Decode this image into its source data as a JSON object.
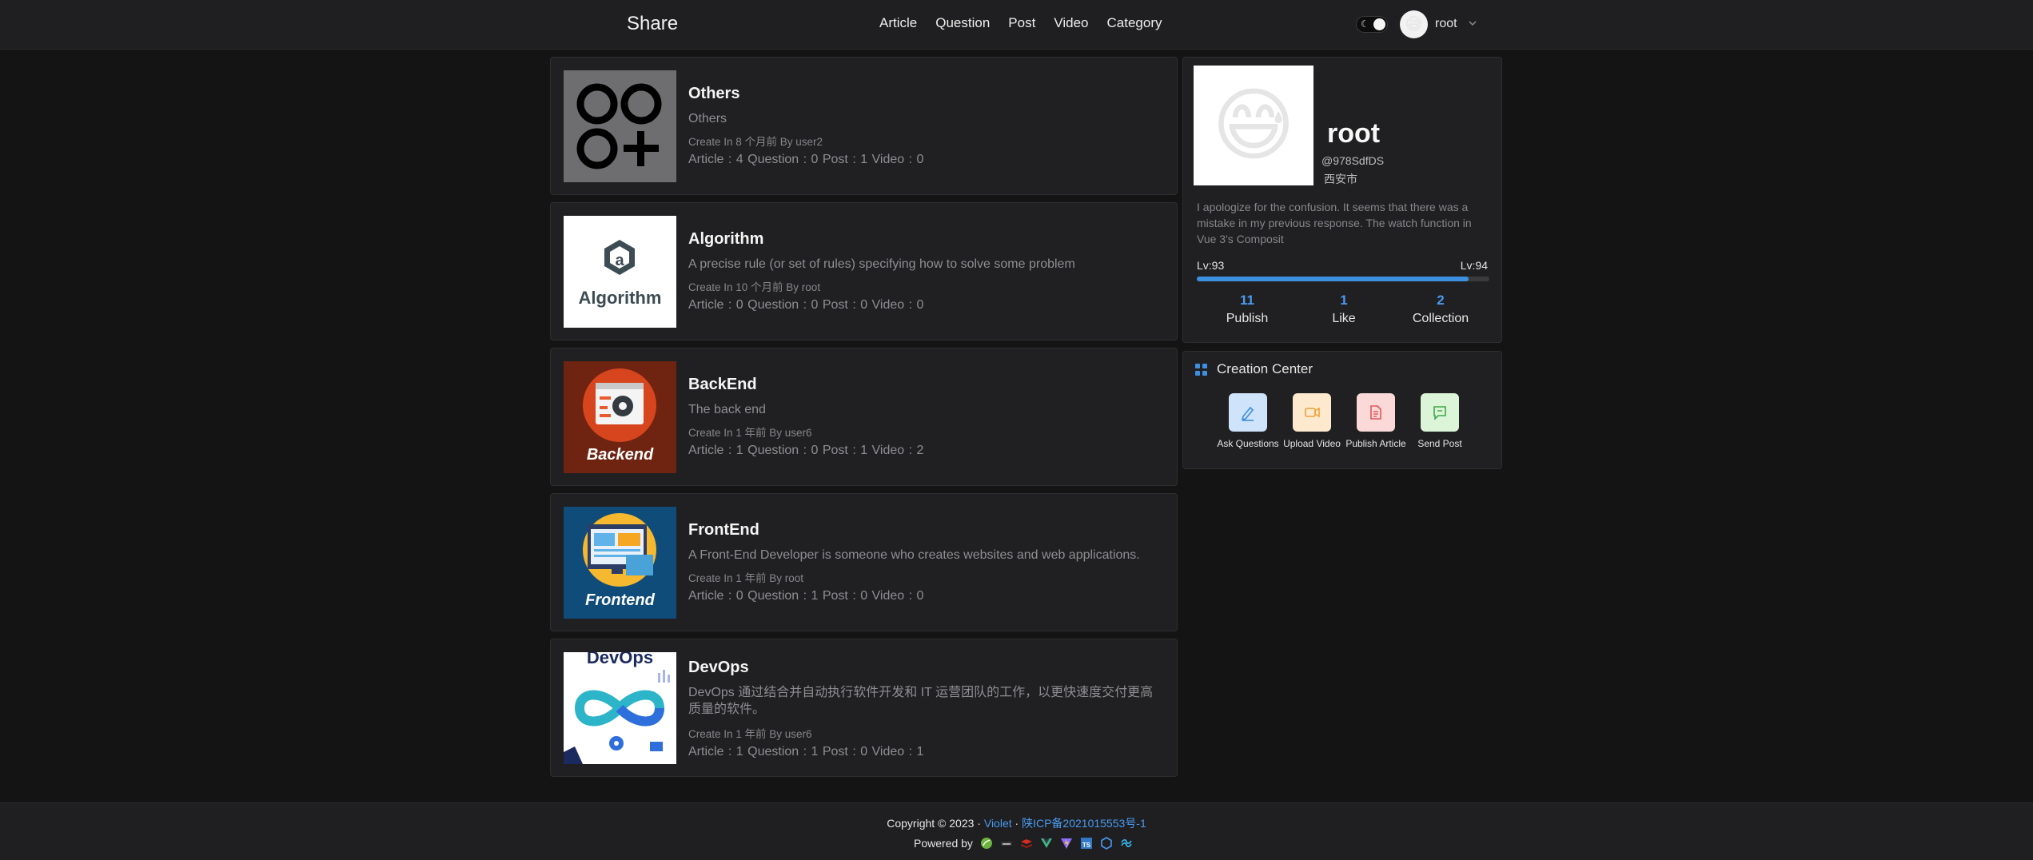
{
  "header": {
    "brand": "Share",
    "nav": [
      "Article",
      "Question",
      "Post",
      "Video",
      "Category"
    ],
    "user": "root",
    "avatar_emoji": "😅"
  },
  "categories": [
    {
      "title": "Others",
      "desc": "Others",
      "meta": "Create In 8 个月前 By user2",
      "stats": "Article : 4   Question : 0   Post : 1   Video : 0",
      "thumb": "others-icon"
    },
    {
      "title": "Algorithm",
      "desc": "A precise rule (or set of rules) specifying how to solve some problem",
      "meta": "Create In 10 个月前 By root",
      "stats": "Article : 0   Question : 0   Post : 0   Video : 0",
      "thumb": "algorithm-logo",
      "thumb_text": "Algorithm"
    },
    {
      "title": "BackEnd",
      "desc": "The back end",
      "meta": "Create In 1 年前 By user6",
      "stats": "Article : 1   Question : 0   Post : 1   Video : 2",
      "thumb": "backend-logo",
      "thumb_text": "Backend"
    },
    {
      "title": "FrontEnd",
      "desc": "A Front-End Developer is someone who creates websites and web applications.",
      "meta": "Create In 1 年前 By root",
      "stats": "Article : 0   Question : 1   Post : 0   Video : 0",
      "thumb": "frontend-logo",
      "thumb_text": "Frontend"
    },
    {
      "title": "DevOps",
      "desc": "DevOps 通过结合并自动执行软件开发和 IT 运营团队的工作，以更快速度交付更高质量的软件。",
      "meta": "Create In 1 年前 By user6",
      "stats": "Article : 1   Question : 1   Post : 0   Video : 1",
      "thumb": "devops-logo",
      "thumb_text": "DevOps"
    }
  ],
  "profile": {
    "name": "root",
    "handle": "@978SdfDS",
    "city": "西安市",
    "bio": "I apologize for the confusion. It seems that there was a mistake in my previous response. The watch function in Vue 3's Composit",
    "level_current": "Lv:93",
    "level_next": "Lv:94",
    "level_progress": 0.93,
    "stats": [
      {
        "num": "11",
        "label": "Publish"
      },
      {
        "num": "1",
        "label": "Like"
      },
      {
        "num": "2",
        "label": "Collection"
      }
    ]
  },
  "creation": {
    "title": "Creation Center",
    "tools": [
      {
        "label": "Ask Questions",
        "icon": "pen-icon",
        "bg": "#cfe3fb",
        "fg": "#3d8fe0"
      },
      {
        "label": "Upload Video",
        "icon": "video-icon",
        "bg": "#fde9cd",
        "fg": "#f0a33c"
      },
      {
        "label": "Publish Article",
        "icon": "document-icon",
        "bg": "#fbd9d9",
        "fg": "#e25555"
      },
      {
        "label": "Send Post",
        "icon": "chat-icon",
        "bg": "#dcf5d8",
        "fg": "#3ea64a"
      }
    ]
  },
  "footer": {
    "copyright": "Copyright © 2023 · ",
    "author": "Violet",
    "sep": " · ",
    "icp": "陕ICP备2021015553号-1",
    "powered": "Powered by"
  },
  "colors": {
    "accent": "#3d8fe0",
    "background": "#141414",
    "card": "#202022"
  }
}
